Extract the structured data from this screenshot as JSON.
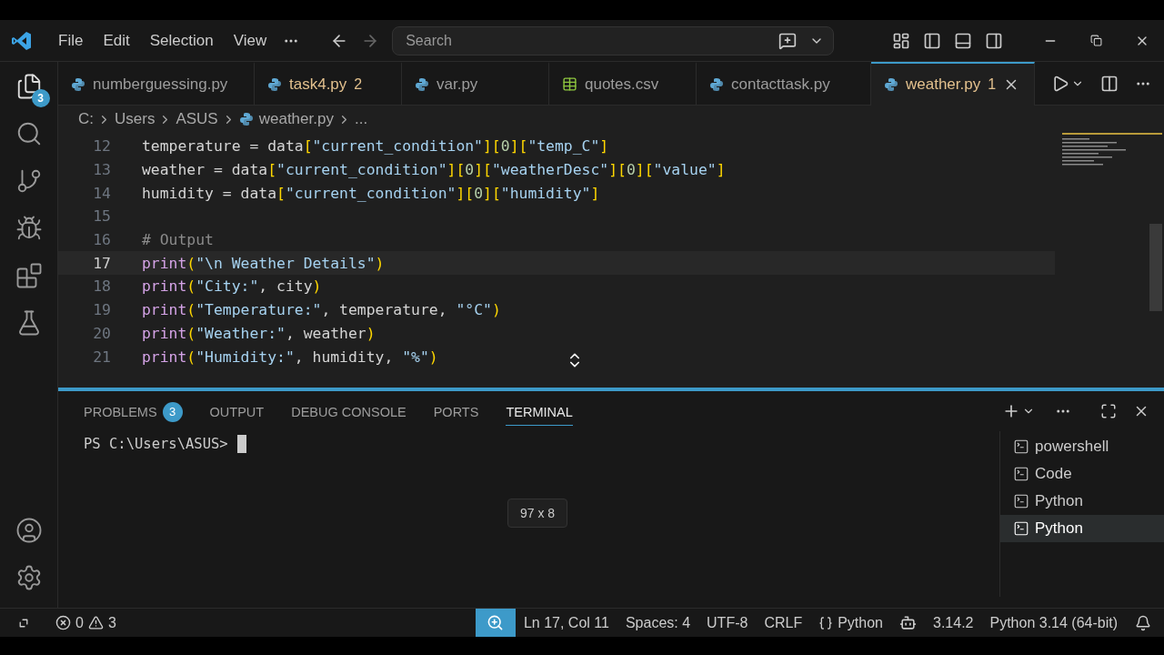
{
  "menu": [
    "File",
    "Edit",
    "Selection",
    "View"
  ],
  "search": {
    "placeholder": "Search"
  },
  "tabs": [
    {
      "label": "numberguessing.py",
      "kind": "python",
      "warning": false,
      "selected": false
    },
    {
      "label": "task4.py",
      "kind": "python",
      "warning": true,
      "count": "2",
      "selected": false
    },
    {
      "label": "var.py",
      "kind": "python",
      "warning": false,
      "selected": false
    },
    {
      "label": "quotes.csv",
      "kind": "csv",
      "warning": false,
      "selected": false
    },
    {
      "label": "contacttask.py",
      "kind": "python",
      "warning": false,
      "selected": false
    },
    {
      "label": "weather.py",
      "kind": "python",
      "warning": true,
      "count": "1",
      "selected": true
    }
  ],
  "explorer_badge": "3",
  "breadcrumb": [
    "C:",
    "Users",
    "ASUS",
    "weather.py",
    "..."
  ],
  "code_lines": [
    {
      "number": "12",
      "current": false,
      "tokens": [
        {
          "kind": "var",
          "text": "temperature = data"
        },
        {
          "kind": "bracket",
          "text": "["
        },
        {
          "kind": "str",
          "text": "\"current_condition\""
        },
        {
          "kind": "bracket",
          "text": "]["
        },
        {
          "kind": "num",
          "text": "0"
        },
        {
          "kind": "bracket",
          "text": "]["
        },
        {
          "kind": "str",
          "text": "\"temp_C\""
        },
        {
          "kind": "bracket",
          "text": "]"
        }
      ]
    },
    {
      "number": "13",
      "current": false,
      "tokens": [
        {
          "kind": "var",
          "text": "weather = data"
        },
        {
          "kind": "bracket",
          "text": "["
        },
        {
          "kind": "str",
          "text": "\"current_condition\""
        },
        {
          "kind": "bracket",
          "text": "]["
        },
        {
          "kind": "num",
          "text": "0"
        },
        {
          "kind": "bracket",
          "text": "]["
        },
        {
          "kind": "str",
          "text": "\"weatherDesc\""
        },
        {
          "kind": "bracket",
          "text": "]["
        },
        {
          "kind": "num",
          "text": "0"
        },
        {
          "kind": "bracket",
          "text": "]["
        },
        {
          "kind": "str",
          "text": "\"value\""
        },
        {
          "kind": "bracket",
          "text": "]"
        }
      ]
    },
    {
      "number": "14",
      "current": false,
      "tokens": [
        {
          "kind": "var",
          "text": "humidity = data"
        },
        {
          "kind": "bracket",
          "text": "["
        },
        {
          "kind": "str",
          "text": "\"current_condition\""
        },
        {
          "kind": "bracket",
          "text": "]["
        },
        {
          "kind": "num",
          "text": "0"
        },
        {
          "kind": "bracket",
          "text": "]["
        },
        {
          "kind": "str",
          "text": "\"humidity\""
        },
        {
          "kind": "bracket",
          "text": "]"
        }
      ]
    },
    {
      "number": "15",
      "current": false
    },
    {
      "number": "16",
      "current": false,
      "tokens": [
        {
          "kind": "comment",
          "text": "# Output"
        }
      ]
    },
    {
      "number": "17",
      "current": true,
      "tokens": [
        {
          "kind": "func",
          "text": "print"
        },
        {
          "kind": "bracket",
          "text": "("
        },
        {
          "kind": "str",
          "text": "\"\\n Weather Details\""
        },
        {
          "kind": "bracket",
          "text": ")"
        }
      ]
    },
    {
      "number": "18",
      "current": false,
      "tokens": [
        {
          "kind": "func",
          "text": "print"
        },
        {
          "kind": "bracket",
          "text": "("
        },
        {
          "kind": "str",
          "text": "\"City:\""
        },
        {
          "kind": "var",
          "text": ", city"
        },
        {
          "kind": "bracket",
          "text": ")"
        }
      ]
    },
    {
      "number": "19",
      "current": false,
      "tokens": [
        {
          "kind": "func",
          "text": "print"
        },
        {
          "kind": "bracket",
          "text": "("
        },
        {
          "kind": "str",
          "text": "\"Temperature:\""
        },
        {
          "kind": "var",
          "text": ", temperature, "
        },
        {
          "kind": "str",
          "text": "\"°C\""
        },
        {
          "kind": "bracket",
          "text": ")"
        }
      ]
    },
    {
      "number": "20",
      "current": false,
      "tokens": [
        {
          "kind": "func",
          "text": "print"
        },
        {
          "kind": "bracket",
          "text": "("
        },
        {
          "kind": "str",
          "text": "\"Weather:\""
        },
        {
          "kind": "var",
          "text": ", weather"
        },
        {
          "kind": "bracket",
          "text": ")"
        }
      ]
    },
    {
      "number": "21",
      "current": false,
      "tokens": [
        {
          "kind": "func",
          "text": "print"
        },
        {
          "kind": "bracket",
          "text": "("
        },
        {
          "kind": "str",
          "text": "\"Humidity:\""
        },
        {
          "kind": "var",
          "text": ", humidity, "
        },
        {
          "kind": "str",
          "text": "\"%\""
        },
        {
          "kind": "bracket",
          "text": ")"
        }
      ]
    }
  ],
  "panel_tabs": [
    {
      "label": "PROBLEMS",
      "badge": "3",
      "selected": false
    },
    {
      "label": "OUTPUT",
      "selected": false
    },
    {
      "label": "DEBUG CONSOLE",
      "selected": false
    },
    {
      "label": "PORTS",
      "selected": false
    },
    {
      "label": "TERMINAL",
      "selected": true
    }
  ],
  "terminal": {
    "prompt": "PS C:\\Users\\ASUS>",
    "tooltip": "97 x 8"
  },
  "terminal_list": [
    {
      "label": "powershell",
      "selected": false
    },
    {
      "label": "Code",
      "selected": false
    },
    {
      "label": "Python",
      "selected": false
    },
    {
      "label": "Python",
      "selected": true
    }
  ],
  "status_bar": {
    "errors": "0",
    "warnings": "3",
    "position": "Ln 17, Col 11",
    "spaces": "Spaces: 4",
    "encoding": "UTF-8",
    "eol": "CRLF",
    "language": "Python",
    "version": "3.14.2",
    "interpreter": "Python 3.14 (64-bit)"
  }
}
